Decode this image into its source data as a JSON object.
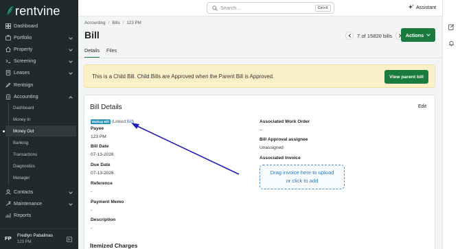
{
  "app": {
    "brand": "rentvine",
    "brand_color": "#22b573"
  },
  "sidebar": {
    "items": [
      {
        "label": "Dashboard",
        "icon": "dashboard-icon"
      },
      {
        "label": "Portfolio",
        "icon": "portfolio-icon",
        "expandable": true
      },
      {
        "label": "Property",
        "icon": "property-icon",
        "expandable": true
      },
      {
        "label": "Screening",
        "icon": "screening-icon",
        "expandable": true
      },
      {
        "label": "Leases",
        "icon": "leases-icon",
        "expandable": true
      },
      {
        "label": "Rentsign",
        "icon": "rentsign-icon"
      },
      {
        "label": "Accounting",
        "icon": "accounting-icon",
        "expanded": true
      }
    ],
    "accounting_sub": [
      "Dashboard",
      "Money In",
      "Money Out",
      "Banking",
      "Transactions",
      "Diagnostics",
      "Manager"
    ],
    "active_sub": "Money Out",
    "bottom_items": [
      {
        "label": "Contacts",
        "icon": "contacts-icon",
        "expandable": true
      },
      {
        "label": "Maintenance",
        "icon": "maintenance-icon",
        "expandable": true
      },
      {
        "label": "Reports",
        "icon": "reports-icon"
      }
    ],
    "user": {
      "initials": "FP",
      "name": "Fredlyn Pabalinas",
      "time": "123 PM"
    }
  },
  "topbar": {
    "search_placeholder": "Search...",
    "search_shortcut": "Ctrl+K",
    "assistant_label": "Assistant"
  },
  "page": {
    "breadcrumb": [
      "Accounting",
      "Bills",
      "123 PM"
    ],
    "title": "Bill",
    "pager": "7 of 15820 bills",
    "actions_label": "Actions",
    "tabs": [
      "Details",
      "Files"
    ],
    "active_tab": "Details",
    "alert_text": "This is a Child Bill. Child Bills are Approved when the Parent Bill is Approved.",
    "parent_button": "View parent bill"
  },
  "bill": {
    "card_title": "Bill Details",
    "edit_label": "Edit",
    "badge": "Markup Bill",
    "linked_prefix": "(Linked: ",
    "linked_link": "Bill",
    "linked_suffix": ")",
    "left_fields": [
      {
        "label": "Payee",
        "value": "123 PM"
      },
      {
        "label": "Bill Date",
        "value": "07-13-2026"
      },
      {
        "label": "Due Date",
        "value": "07-13-2026"
      },
      {
        "label": "Reference",
        "value": "-"
      },
      {
        "label": "Payment Memo",
        "value": "-"
      },
      {
        "label": "Description",
        "value": "-"
      }
    ],
    "right_fields": [
      {
        "label": "Associated Work Order",
        "value": "--"
      },
      {
        "label": "Bill Approval assignee",
        "value": "Unassigned"
      },
      {
        "label": "Associated Invoice",
        "value": ""
      }
    ],
    "dropzone_line1": "Drag invoice here to upload",
    "dropzone_line2": "or click to add",
    "itemized_title": "Itemized Charges"
  },
  "colors": {
    "primary_green": "#1b7a3d",
    "sidebar_bg": "#1f2a2c",
    "link": "#2a6fdb",
    "alert_bg": "#fbf1c8",
    "annotation_arrow": "#1f1fb8"
  }
}
